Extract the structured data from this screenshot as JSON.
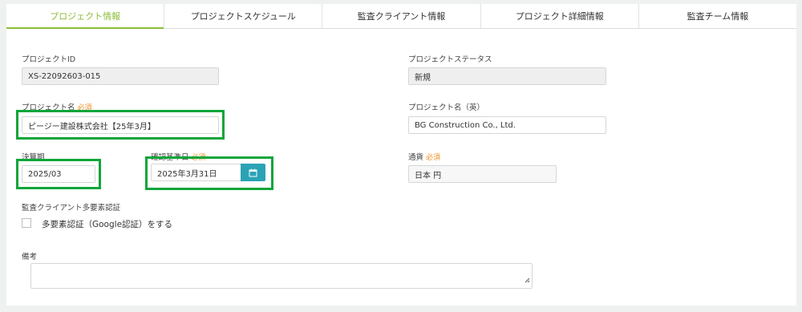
{
  "tabs": [
    {
      "label": "プロジェクト情報",
      "active": true
    },
    {
      "label": "プロジェクトスケジュール",
      "active": false
    },
    {
      "label": "監査クライアント情報",
      "active": false
    },
    {
      "label": "プロジェクト詳細情報",
      "active": false
    },
    {
      "label": "監査チーム情報",
      "active": false
    }
  ],
  "form": {
    "project_id": {
      "label": "プロジェクトID",
      "value": "XS-22092603-015"
    },
    "project_status": {
      "label": "プロジェクトステータス",
      "value": "新規"
    },
    "project_name": {
      "label": "プロジェクト名",
      "required": "必須",
      "value": "ピージー建設株式会社【25年3月】"
    },
    "project_name_en": {
      "label": "プロジェクト名（英）",
      "value": "BG Construction Co., Ltd."
    },
    "fiscal_period": {
      "label": "決算期",
      "value": "2025/03"
    },
    "base_date": {
      "label": "確認基準日",
      "required": "必須",
      "value": "2025年3月31日"
    },
    "currency": {
      "label": "通貨",
      "required": "必須",
      "value": "日本 円"
    },
    "mfa": {
      "label": "監査クライアント多要素認証",
      "checkbox_label": "多要素認証（Google認証）をする",
      "checked": false
    },
    "remarks": {
      "label": "備考",
      "value": ""
    }
  },
  "colors": {
    "accent": "#8cbd3a",
    "required": "#f08c1e",
    "highlight": "#0fa53a",
    "calendar_button": "#2aa3b5"
  },
  "icons": {
    "calendar": "calendar-icon",
    "resize": "resize-grip-icon"
  }
}
